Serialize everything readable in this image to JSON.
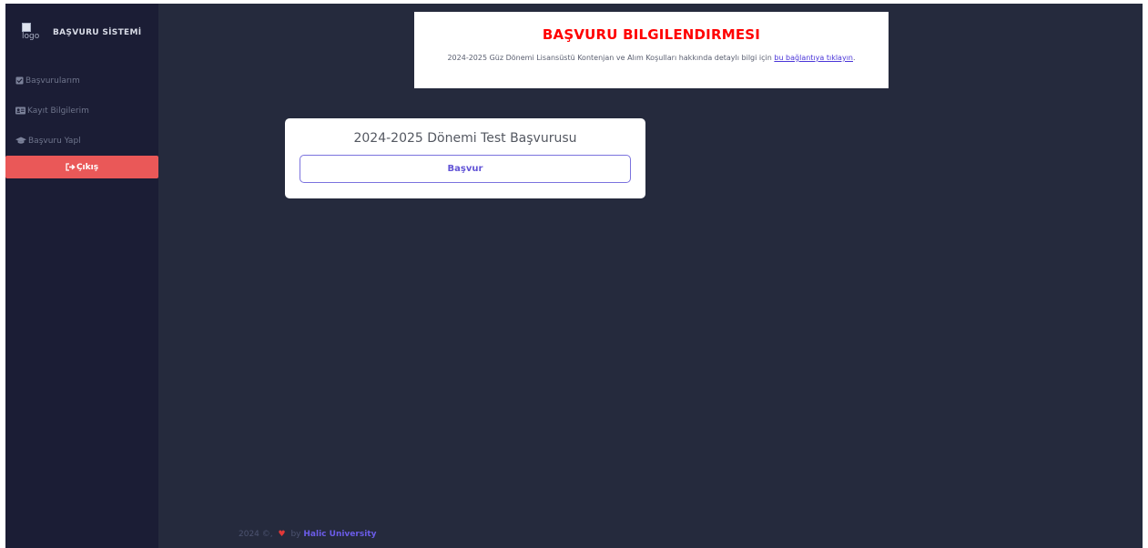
{
  "brand": {
    "logo_alt": "logo",
    "title": "BAŞVURU SİSTEMİ"
  },
  "sidebar": {
    "items": [
      {
        "label": "Başvurularım",
        "icon": "checkbox-icon"
      },
      {
        "label": "Kayıt Bilgilerim",
        "icon": "id-card-icon"
      },
      {
        "label": "Başvuru Yapl",
        "icon": "graduation-cap-icon"
      }
    ],
    "logout_label": "Çıkış",
    "logout_icon": "sign-out-icon"
  },
  "info": {
    "title": "BAŞVURU BILGILENDIRMESI",
    "text": "2024-2025 Güz Dönemi Lisansüstü Kontenjan ve Alım Koşulları hakkında detaylı bilgi için ",
    "link": "bu bağlantıya tıklayın",
    "text_end": "."
  },
  "application_card": {
    "title": "2024-2025 Dönemi Test Başvurusu",
    "button": "Başvur"
  },
  "footer": {
    "text": "2024 ©,",
    "by": "by",
    "brand": "Halic University"
  },
  "colors": {
    "sidebar_bg": "#1b1d35",
    "main_bg": "#252a3d",
    "logout_bg": "#ea5858",
    "title_red": "#ff0000",
    "accent": "#6254d6"
  }
}
